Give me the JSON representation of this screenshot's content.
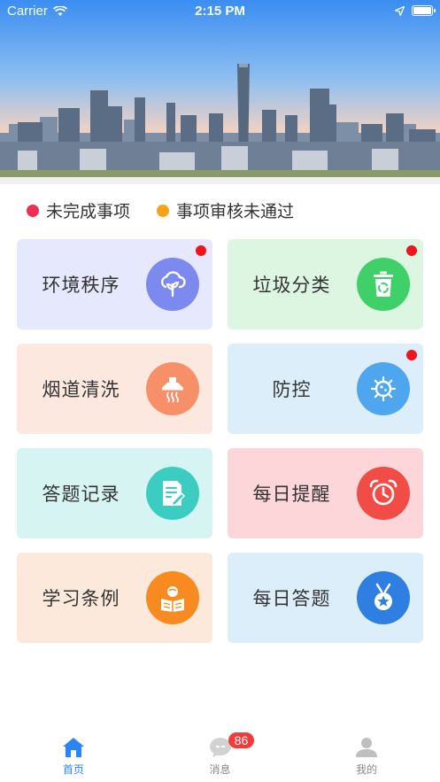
{
  "status_bar": {
    "carrier": "Carrier",
    "time": "2:15 PM"
  },
  "legend": [
    {
      "label": "未完成事项",
      "color": "#ee2f53"
    },
    {
      "label": "事项审核未通过",
      "color": "#f8a21a"
    }
  ],
  "cards": [
    {
      "label": "环境秩序",
      "icon": "cloud-plant-icon",
      "bg": "#e6e9fd",
      "circle": "#7c8af0",
      "badge": true
    },
    {
      "label": "垃圾分类",
      "icon": "recycle-bin-icon",
      "bg": "#dcf6e2",
      "circle": "#3fd069",
      "badge": true
    },
    {
      "label": "烟道清洗",
      "icon": "range-hood-icon",
      "bg": "#fde8df",
      "circle": "#f79068",
      "badge": false
    },
    {
      "label": "防控",
      "icon": "virus-icon",
      "bg": "#ddeefb",
      "circle": "#4ea6ef",
      "badge": true
    },
    {
      "label": "答题记录",
      "icon": "document-edit-icon",
      "bg": "#d6f4f2",
      "circle": "#3ccdc2",
      "badge": false
    },
    {
      "label": "每日提醒",
      "icon": "alarm-clock-icon",
      "bg": "#fcd6d9",
      "circle": "#f24c46",
      "badge": false
    },
    {
      "label": "学习条例",
      "icon": "reading-person-icon",
      "bg": "#fde9dc",
      "circle": "#f78b20",
      "badge": false
    },
    {
      "label": "每日答题",
      "icon": "medal-icon",
      "bg": "#ddeefb",
      "circle": "#2f7fe3",
      "badge": false
    }
  ],
  "tabs": [
    {
      "label": "首页",
      "icon": "home-icon",
      "active": true
    },
    {
      "label": "消息",
      "icon": "message-icon",
      "active": false,
      "badge": "86"
    },
    {
      "label": "我的",
      "icon": "user-icon",
      "active": false
    }
  ],
  "colors": {
    "accent": "#2b84f6",
    "badge_red": "#f0141e"
  }
}
